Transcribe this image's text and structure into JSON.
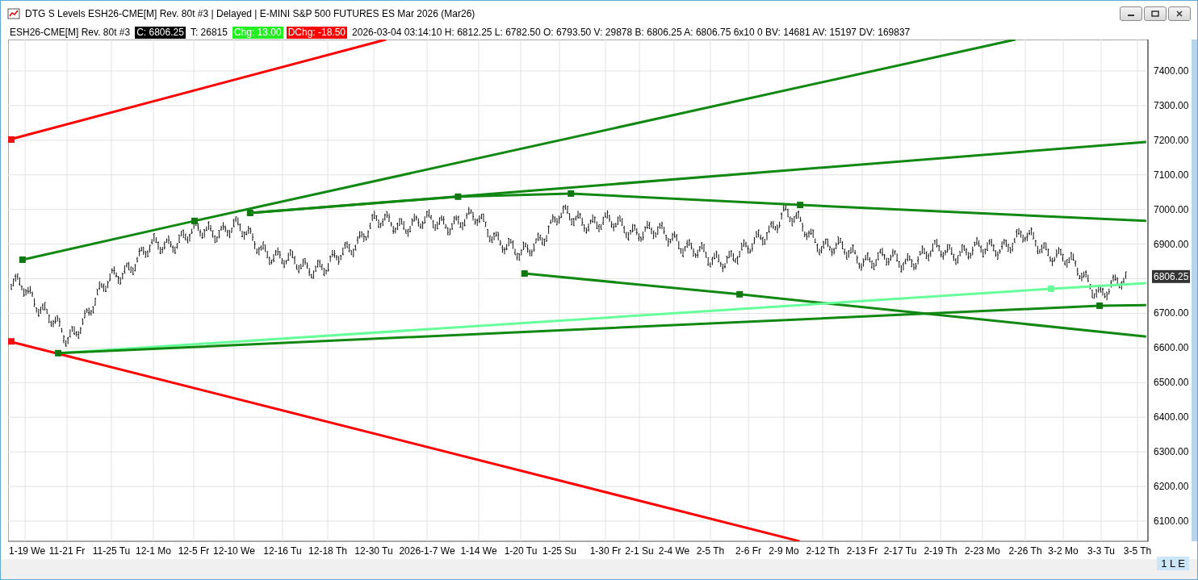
{
  "window": {
    "title": "DTG S Levels ESH26-CME[M]  Rev. 80t #3 | Delayed | E-MINI S&P 500 FUTURES ES Mar 2026 (Mar26)"
  },
  "quote_bar": [
    {
      "text": "ESH26-CME[M]  Rev. 80t #3",
      "kind": "plain"
    },
    {
      "text": "C: 6806.25",
      "kind": "dark"
    },
    {
      "text": "T: 26815",
      "kind": "plain"
    },
    {
      "text": "Chg: 13.00",
      "kind": "up"
    },
    {
      "text": "DChg: -18.50",
      "kind": "down"
    },
    {
      "text": "2026-03-04 03:14:10 H: 6812.25 L: 6782.50 O: 6793.50 V: 29878 B: 6806.25 A: 6806.75 6x10 0 BV: 14681 AV: 15197 DV: 169837",
      "kind": "plain"
    }
  ],
  "chart": {
    "last_price": "6806.25",
    "y_axis_labels": [
      "7400.00",
      "7300.00",
      "7200.00",
      "7100.00",
      "7000.00",
      "6900.00",
      "6700.00",
      "6600.00",
      "6500.00",
      "6400.00",
      "6300.00",
      "6200.00",
      "6100.00"
    ],
    "x_axis_labels": [
      "1-19 We",
      "11-21 Fr",
      "11-25 Tu",
      "12-1 Mo",
      "12-5 Fr",
      "12-10 We",
      "12-16 Tu",
      "12-18 Th",
      "12-30 Tu",
      "2026-1-7 We",
      "1-14 We",
      "1-20 Tu",
      "1-25 Su",
      "1-30 Fr",
      "2-1 Su",
      "2-4 We",
      "2-5 Th",
      "2-6 Fr",
      "2-9 Mo",
      "2-12 Th",
      "2-13 Fr",
      "2-17 Tu",
      "2-19 Th",
      "2-23 Mo",
      "2-26 Th",
      "3-2 Mo",
      "3-3 Tu",
      "3-5 Th"
    ]
  },
  "status_badge": "1 L E"
}
